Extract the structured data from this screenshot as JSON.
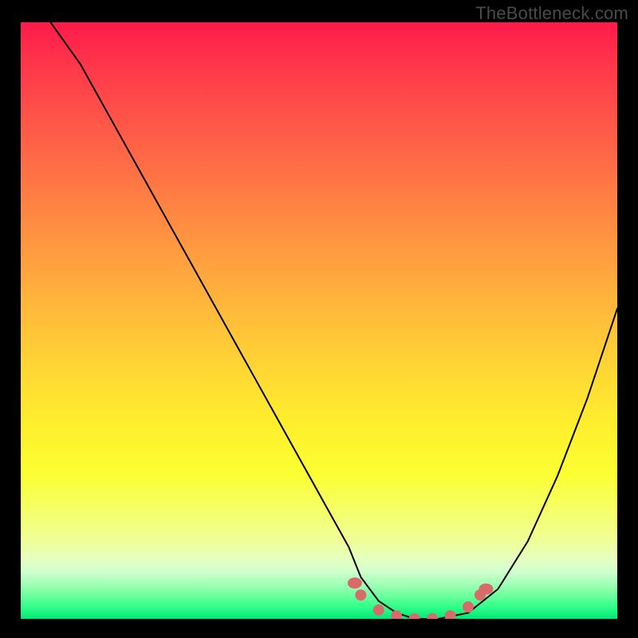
{
  "watermark": "TheBottleneck.com",
  "chart_data": {
    "type": "line",
    "title": "",
    "xlabel": "",
    "ylabel": "",
    "xlim": [
      0,
      100
    ],
    "ylim": [
      0,
      100
    ],
    "grid": false,
    "legend": false,
    "background": {
      "type": "vertical-gradient",
      "stops": [
        {
          "pos": 0,
          "color": "#ff1a4b"
        },
        {
          "pos": 50,
          "color": "#ffc837"
        },
        {
          "pos": 82,
          "color": "#f6ff6a"
        },
        {
          "pos": 100,
          "color": "#00e878"
        }
      ]
    },
    "series": [
      {
        "name": "bottleneck-curve",
        "x": [
          5,
          10,
          15,
          20,
          25,
          30,
          35,
          40,
          45,
          50,
          55,
          57,
          60,
          63,
          66,
          70,
          75,
          80,
          85,
          90,
          95,
          100
        ],
        "y": [
          100,
          93,
          84,
          75,
          66,
          57,
          48,
          39,
          30,
          21,
          12,
          7,
          3,
          1,
          0,
          0,
          1,
          5,
          13,
          24,
          37,
          52
        ]
      }
    ],
    "markers": {
      "name": "optimal-range-dots",
      "color": "#d86a6a",
      "points": [
        {
          "x": 56,
          "y": 6
        },
        {
          "x": 57,
          "y": 4
        },
        {
          "x": 60,
          "y": 1.5
        },
        {
          "x": 63,
          "y": 0.5
        },
        {
          "x": 66,
          "y": 0
        },
        {
          "x": 69,
          "y": 0
        },
        {
          "x": 72,
          "y": 0.5
        },
        {
          "x": 75,
          "y": 2
        },
        {
          "x": 77,
          "y": 4
        },
        {
          "x": 78,
          "y": 5
        }
      ]
    }
  }
}
